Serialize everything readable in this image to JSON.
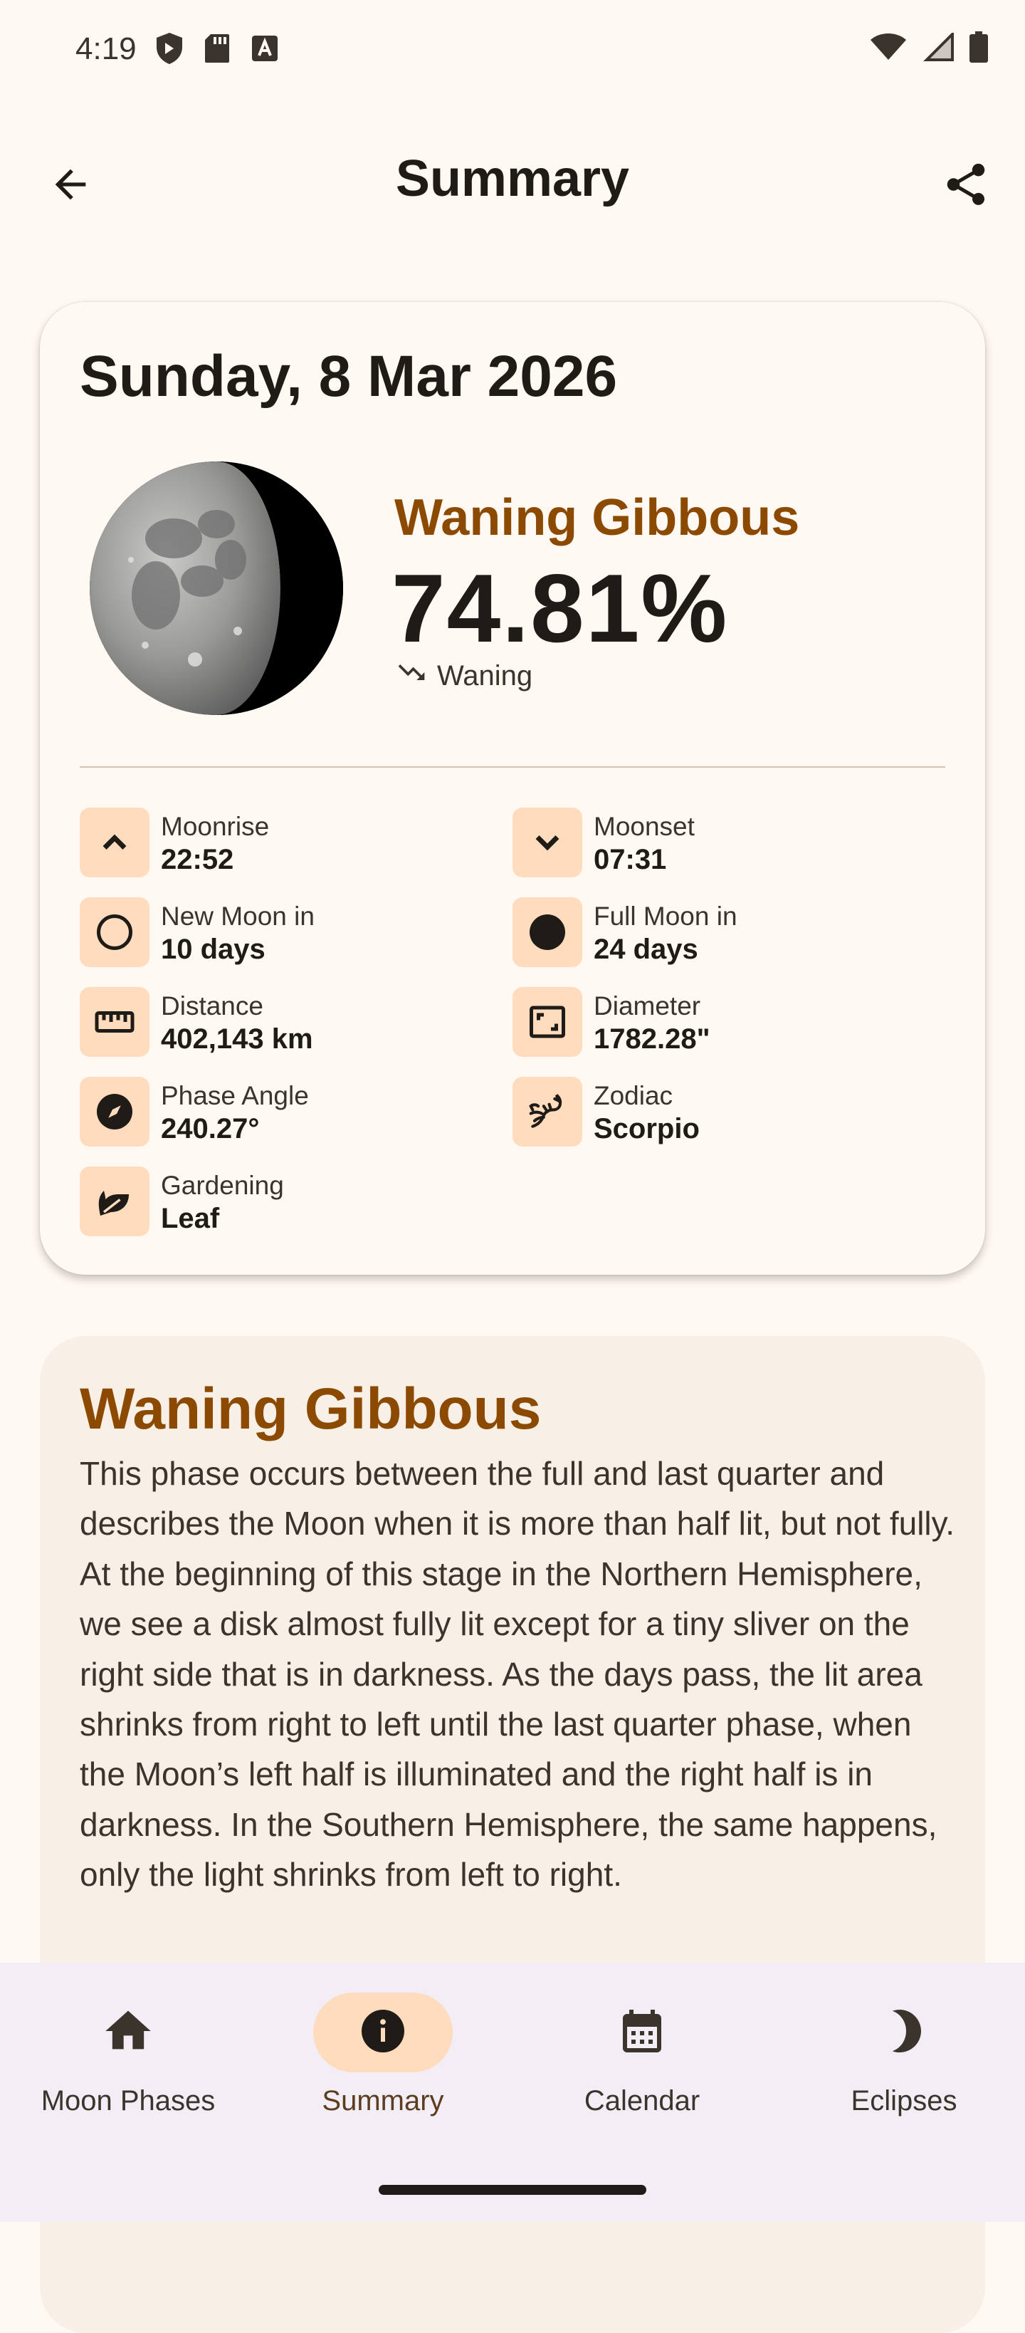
{
  "status_bar": {
    "time": "4:19",
    "left_icons": [
      "shield-icon",
      "sd-card-icon",
      "keyboard-a-icon"
    ],
    "right_icons": [
      "wifi-icon",
      "cell-signal-icon",
      "battery-icon"
    ]
  },
  "top_bar": {
    "title": "Summary",
    "back_icon": "arrow-back-icon",
    "share_icon": "share-icon"
  },
  "summary_card": {
    "date": "Sunday, 8 Mar 2026",
    "phase_name": "Waning Gibbous",
    "illumination": "74.81%",
    "trend_label": "Waning",
    "stats": [
      {
        "label": "Moonrise",
        "value": "22:52",
        "icon": "chevron-up-icon"
      },
      {
        "label": "Moonset",
        "value": "07:31",
        "icon": "chevron-down-icon"
      },
      {
        "label": "New Moon in",
        "value": "10 days",
        "icon": "circle-outline-icon"
      },
      {
        "label": "Full Moon in",
        "value": "24 days",
        "icon": "circle-filled-icon"
      },
      {
        "label": "Distance",
        "value": "402,143 km",
        "icon": "ruler-icon"
      },
      {
        "label": "Diameter",
        "value": "1782.28\"",
        "icon": "aspect-ratio-icon"
      },
      {
        "label": "Phase Angle",
        "value": "240.27°",
        "icon": "compass-icon"
      },
      {
        "label": "Zodiac",
        "value": "Scorpio",
        "icon": "scorpio-icon"
      },
      {
        "label": "Gardening",
        "value": "Leaf",
        "icon": "leaf-icon"
      }
    ]
  },
  "description": {
    "title": "Waning Gibbous",
    "body": "This phase occurs between the full and last quarter and describes the Moon when it is more than half lit, but not fully. At the beginning of this stage in the Northern Hemisphere, we see a disk almost fully lit except for a tiny sliver on the right side that is in darkness. As the days pass, the lit area shrinks from right to left until the last quarter phase, when the Moon’s left half is illuminated and the right half is in darkness. In the Southern Hemisphere, the same happens, only the light shrinks from left to right."
  },
  "nav": {
    "items": [
      {
        "label": "Moon Phases",
        "icon": "home-icon",
        "active": false
      },
      {
        "label": "Summary",
        "icon": "info-icon",
        "active": true
      },
      {
        "label": "Calendar",
        "icon": "calendar-icon",
        "active": false
      },
      {
        "label": "Eclipses",
        "icon": "crescent-moon-icon",
        "active": false
      }
    ]
  },
  "colors": {
    "accent": "#8b4a00",
    "icon_tile": "#ffdcbd",
    "background": "#fff8f3",
    "nav_background": "#f3edf6"
  }
}
